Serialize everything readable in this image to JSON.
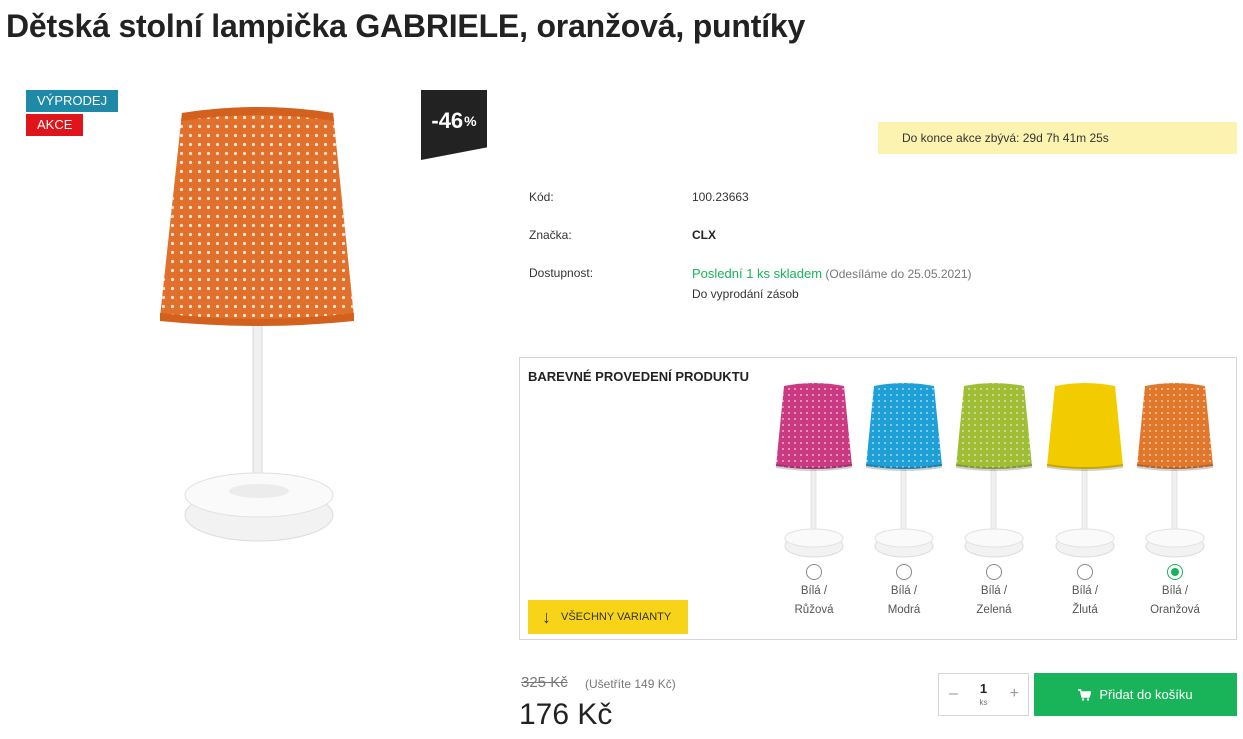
{
  "product": {
    "title": "Dětská stolní lampička GABRIELE, oranžová, puntíky"
  },
  "badges": {
    "sale": "VÝPRODEJ",
    "akce": "AKCE"
  },
  "discount": {
    "value": "-46",
    "unit": "%"
  },
  "countdown": {
    "text": "Do konce akce zbývá: 29d 7h 41m 25s"
  },
  "info": {
    "code_label": "Kód:",
    "code_value": "100.23663",
    "brand_label": "Značka:",
    "brand_value": "CLX",
    "availability_label": "Dostupnost:",
    "availability_value": "Poslední 1 ks skladem",
    "availability_note": "(Odesíláme do 25.05.2021)",
    "availability_sub": "Do vyprodání zásob"
  },
  "variants": {
    "heading": "BAREVNÉ PROVEDENÍ PRODUKTU",
    "all_button": "VŠECHNY VARIANTY",
    "items": [
      {
        "line1": "Bílá /",
        "line2": "Růžová",
        "color": "#c93a82",
        "dots": true,
        "selected": false
      },
      {
        "line1": "Bílá /",
        "line2": "Modrá",
        "color": "#1e9fd6",
        "dots": true,
        "selected": false
      },
      {
        "line1": "Bílá /",
        "line2": "Zelená",
        "color": "#9fbe36",
        "dots": true,
        "selected": false
      },
      {
        "line1": "Bílá /",
        "line2": "Žlutá",
        "color": "#f3cc00",
        "dots": false,
        "selected": false
      },
      {
        "line1": "Bílá /",
        "line2": "Oranžová",
        "color": "#e0772a",
        "dots": true,
        "selected": true
      }
    ]
  },
  "price": {
    "old": "325 Kč",
    "save": "(Ušetříte 149 Kč)",
    "current": "176 Kč"
  },
  "cart": {
    "qty_minus": "–",
    "qty_value": "1",
    "qty_unit": "ks",
    "qty_plus": "+",
    "button": "Přidat do košíku"
  },
  "icons": {
    "cart": "cart-icon",
    "arrow": "arrow-down-icon"
  }
}
